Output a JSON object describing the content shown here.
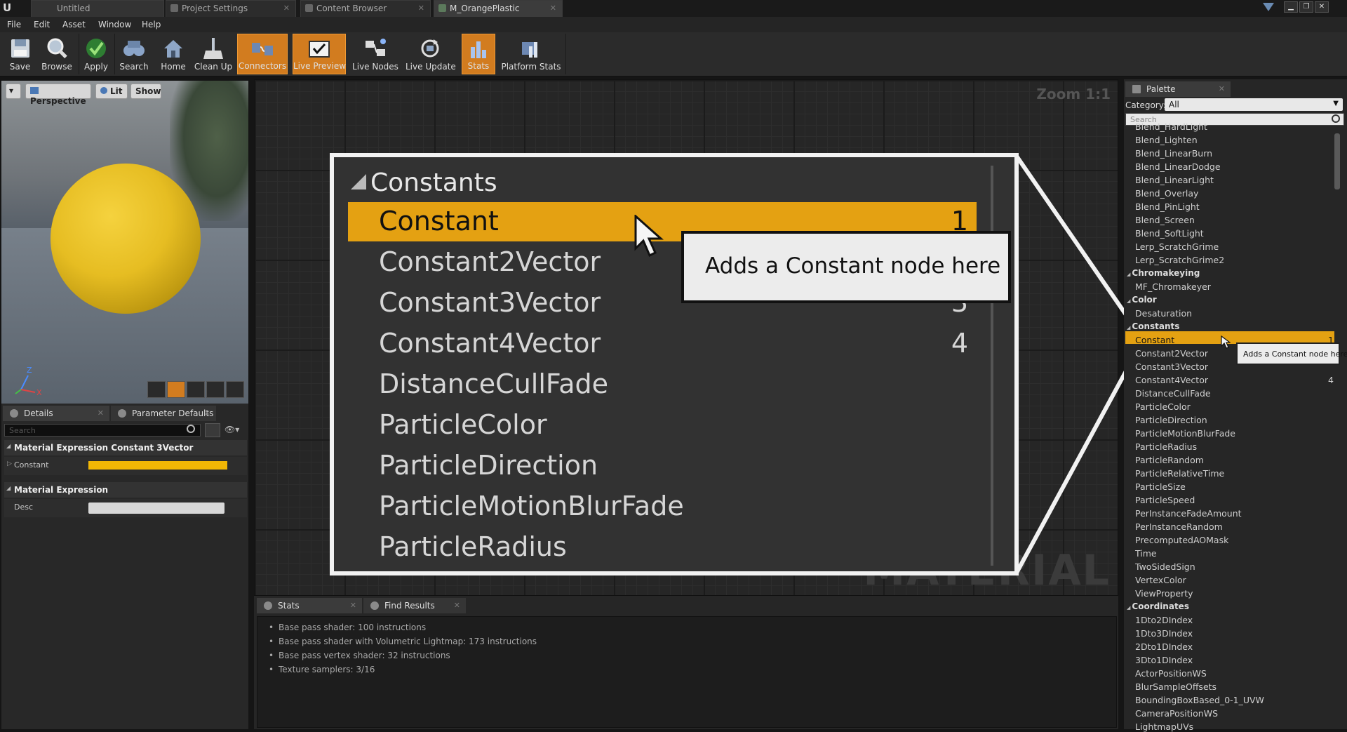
{
  "window": {
    "tabs": [
      "Untitled",
      "Project Settings",
      "Content Browser",
      "M_OrangePlastic"
    ],
    "minimize": "▁",
    "restore": "❐",
    "close": "✕"
  },
  "menu": [
    "File",
    "Edit",
    "Asset",
    "Window",
    "Help"
  ],
  "toolbar": {
    "save": "Save",
    "browse": "Browse",
    "apply": "Apply",
    "search": "Search",
    "home": "Home",
    "cleanup": "Clean Up",
    "connectors": "Connectors",
    "live_preview": "Live Preview",
    "live_nodes": "Live Nodes",
    "live_update": "Live Update",
    "stats": "Stats",
    "platform_stats": "Platform Stats"
  },
  "viewport": {
    "menu_arrow": "▾",
    "perspective": "Perspective",
    "lit": "Lit",
    "show": "Show",
    "axis_z": "Z",
    "axis_x": "X",
    "accent": "#e6bd22"
  },
  "details": {
    "tab_details": "Details",
    "tab_params": "Parameter Defaults",
    "search_placeholder": "Search",
    "cat1": "Material Expression Constant 3Vector",
    "constant_label": "Constant",
    "constant_color": "#f2b705",
    "cat2": "Material Expression",
    "desc_label": "Desc"
  },
  "graph": {
    "zoom": "Zoom 1:1",
    "watermark": "MATERIAL"
  },
  "callout": {
    "category": "Constants",
    "items": [
      {
        "name": "Constant",
        "num": "1"
      },
      {
        "name": "Constant2Vector",
        "num": ""
      },
      {
        "name": "Constant3Vector",
        "num": "3"
      },
      {
        "name": "Constant4Vector",
        "num": "4"
      },
      {
        "name": "DistanceCullFade",
        "num": ""
      },
      {
        "name": "ParticleColor",
        "num": ""
      },
      {
        "name": "ParticleDirection",
        "num": ""
      },
      {
        "name": "ParticleMotionBlurFade",
        "num": ""
      },
      {
        "name": "ParticleRadius",
        "num": ""
      }
    ],
    "tooltip": "Adds a Constant node here"
  },
  "stats": {
    "tab_stats": "Stats",
    "tab_find": "Find Results",
    "lines": [
      "Base pass shader: 100 instructions",
      "Base pass shader with Volumetric Lightmap: 173 instructions",
      "Base pass vertex shader: 32 instructions",
      "Texture samplers: 3/16"
    ]
  },
  "palette": {
    "tab": "Palette",
    "category_label": "Category:",
    "category_value": "All",
    "search_placeholder": "Search",
    "items": [
      {
        "type": "item",
        "label": "Blend_HardLight"
      },
      {
        "type": "item",
        "label": "Blend_Lighten"
      },
      {
        "type": "item",
        "label": "Blend_LinearBurn"
      },
      {
        "type": "item",
        "label": "Blend_LinearDodge"
      },
      {
        "type": "item",
        "label": "Blend_LinearLight"
      },
      {
        "type": "item",
        "label": "Blend_Overlay"
      },
      {
        "type": "item",
        "label": "Blend_PinLight"
      },
      {
        "type": "item",
        "label": "Blend_Screen"
      },
      {
        "type": "item",
        "label": "Blend_SoftLight"
      },
      {
        "type": "item",
        "label": "Lerp_ScratchGrime"
      },
      {
        "type": "item",
        "label": "Lerp_ScratchGrime2"
      },
      {
        "type": "cat",
        "label": "Chromakeying"
      },
      {
        "type": "item",
        "label": "MF_Chromakeyer"
      },
      {
        "type": "cat",
        "label": "Color"
      },
      {
        "type": "item",
        "label": "Desaturation"
      },
      {
        "type": "cat",
        "label": "Constants"
      },
      {
        "type": "sel",
        "label": "Constant",
        "num": "1"
      },
      {
        "type": "item",
        "label": "Constant2Vector"
      },
      {
        "type": "item",
        "label": "Constant3Vector"
      },
      {
        "type": "item",
        "label": "Constant4Vector",
        "num": "4"
      },
      {
        "type": "item",
        "label": "DistanceCullFade"
      },
      {
        "type": "item",
        "label": "ParticleColor"
      },
      {
        "type": "item",
        "label": "ParticleDirection"
      },
      {
        "type": "item",
        "label": "ParticleMotionBlurFade"
      },
      {
        "type": "item",
        "label": "ParticleRadius"
      },
      {
        "type": "item",
        "label": "ParticleRandom"
      },
      {
        "type": "item",
        "label": "ParticleRelativeTime"
      },
      {
        "type": "item",
        "label": "ParticleSize"
      },
      {
        "type": "item",
        "label": "ParticleSpeed"
      },
      {
        "type": "item",
        "label": "PerInstanceFadeAmount"
      },
      {
        "type": "item",
        "label": "PerInstanceRandom"
      },
      {
        "type": "item",
        "label": "PrecomputedAOMask"
      },
      {
        "type": "item",
        "label": "Time"
      },
      {
        "type": "item",
        "label": "TwoSidedSign"
      },
      {
        "type": "item",
        "label": "VertexColor"
      },
      {
        "type": "item",
        "label": "ViewProperty"
      },
      {
        "type": "cat",
        "label": "Coordinates"
      },
      {
        "type": "item",
        "label": "1Dto2DIndex"
      },
      {
        "type": "item",
        "label": "1Dto3DIndex"
      },
      {
        "type": "item",
        "label": "2Dto1DIndex"
      },
      {
        "type": "item",
        "label": "3Dto1DIndex"
      },
      {
        "type": "item",
        "label": "ActorPositionWS"
      },
      {
        "type": "item",
        "label": "BlurSampleOffsets"
      },
      {
        "type": "item",
        "label": "BoundingBoxBased_0-1_UVW"
      },
      {
        "type": "item",
        "label": "CameraPositionWS"
      },
      {
        "type": "item",
        "label": "LightmapUVs"
      }
    ],
    "tooltip": "Adds a Constant node here"
  }
}
